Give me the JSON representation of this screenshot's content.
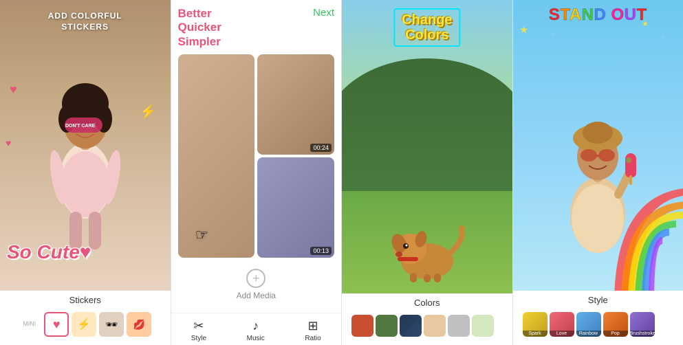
{
  "panels": [
    {
      "id": "stickers",
      "header": "ADD COLORFUL\nSTICKERS",
      "footer_label": "Stickers",
      "so_cute": "So Cute",
      "heart": "♥",
      "thumbs": [
        {
          "label": "♥",
          "active": true,
          "color": "#e8547a"
        },
        {
          "label": "⚡",
          "active": false,
          "color": "#ffe066"
        },
        {
          "label": "🕶",
          "active": false,
          "color": "#d4c0a0"
        },
        {
          "label": "💋",
          "active": false,
          "color": "#ff8866"
        }
      ],
      "mini_label": "MINI"
    },
    {
      "id": "media",
      "tagline": "Better\nQuicker\nSimpler",
      "next_label": "Next",
      "media_items": [
        {
          "duration": "00:24",
          "type": "portrait"
        },
        {
          "duration": "",
          "type": "square"
        },
        {
          "duration": "00:13",
          "type": "square"
        }
      ],
      "add_media_label": "Add Media",
      "toolbar": [
        {
          "icon": "✂",
          "label": "Style"
        },
        {
          "icon": "♪",
          "label": "Music"
        },
        {
          "icon": "⊞",
          "label": "Ratio"
        }
      ]
    },
    {
      "id": "colors",
      "change_colors_line1": "Change",
      "change_colors_line2": "Colors",
      "footer_label": "Colors",
      "swatches": [
        "#c85030",
        "#507840",
        "#203850",
        "#e8c8a0",
        "#c0c0c0",
        "#d4e8c0",
        "#f0c8b0",
        "#d8b0c8"
      ]
    },
    {
      "id": "style",
      "stand_out": "STAND OUT",
      "footer_label": "Style",
      "style_thumbs": [
        {
          "label": "Spark",
          "color": "#e8c030"
        },
        {
          "label": "Love",
          "color": "#e86070"
        },
        {
          "label": "Rainbow",
          "color": "#70c0e8"
        },
        {
          "label": "Pop",
          "color": "#e88030"
        },
        {
          "label": "Brushstroke",
          "color": "#8870c0"
        }
      ]
    }
  ]
}
